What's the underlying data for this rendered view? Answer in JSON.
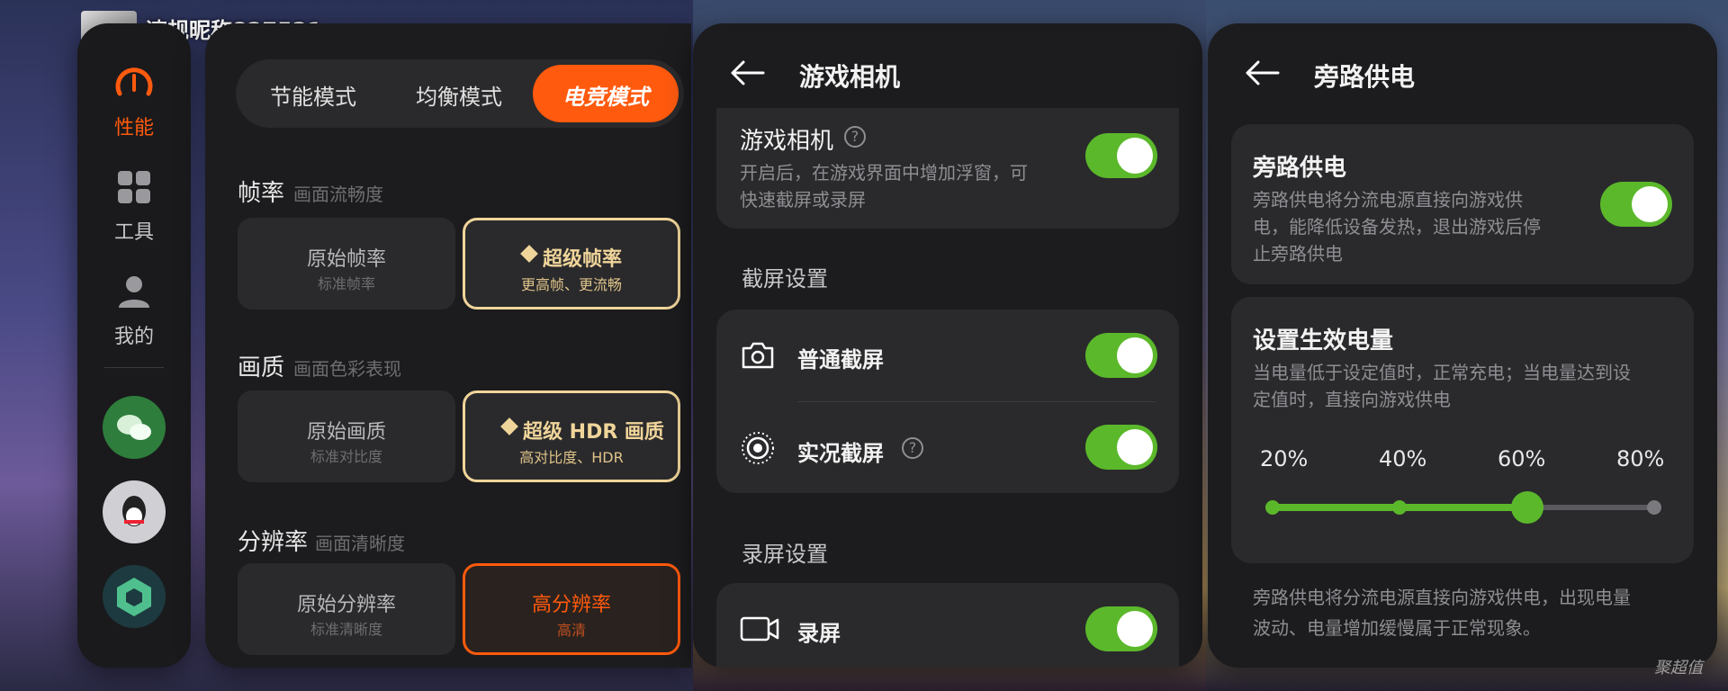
{
  "username": "违规昵称827521",
  "left_panel": {
    "nav": [
      {
        "label": "性能",
        "icon": "speedometer-icon",
        "active": true
      },
      {
        "label": "工具",
        "icon": "grid-icon",
        "active": false
      },
      {
        "label": "我的",
        "icon": "person-icon",
        "active": false
      }
    ],
    "apps": [
      "wechat-icon",
      "qq-icon",
      "cube-app-icon"
    ],
    "modes": [
      "节能模式",
      "均衡模式",
      "电竞模式"
    ],
    "active_mode": "电竞模式",
    "sections": [
      {
        "title": "帧率",
        "subtitle": "画面流畅度",
        "options": [
          {
            "title": "原始帧率",
            "desc": "标准帧率",
            "selected": false
          },
          {
            "title": "超级帧率",
            "desc": "更高帧、更流畅",
            "selected": true,
            "premium": true
          }
        ]
      },
      {
        "title": "画质",
        "subtitle": "画面色彩表现",
        "options": [
          {
            "title": "原始画质",
            "desc": "标准对比度",
            "selected": false
          },
          {
            "title": "超级 HDR 画质",
            "desc": "高对比度、HDR",
            "selected": true,
            "premium": true
          }
        ]
      },
      {
        "title": "分辨率",
        "subtitle": "画面清晰度",
        "options": [
          {
            "title": "原始分辨率",
            "desc": "标准清晰度",
            "selected": false
          },
          {
            "title": "高分辨率",
            "desc": "高清",
            "selected": true,
            "premium": false
          }
        ]
      }
    ]
  },
  "camera_panel": {
    "title": "游戏相机",
    "main_toggle": {
      "label": "游戏相机",
      "desc_line1": "开启后，在游戏界面中增加浮窗，可",
      "desc_line2": "快速截屏或录屏",
      "on": true
    },
    "screenshot_header": "截屏设置",
    "screenshot_items": [
      {
        "label": "普通截屏",
        "icon": "camera-icon",
        "on": true,
        "help": false
      },
      {
        "label": "实况截屏",
        "icon": "live-photo-icon",
        "on": true,
        "help": true
      }
    ],
    "record_header": "录屏设置",
    "record_items": [
      {
        "label": "录屏",
        "icon": "video-icon",
        "on": true
      }
    ]
  },
  "bypass_panel": {
    "title": "旁路供电",
    "toggle": {
      "label": "旁路供电",
      "desc_line1": "旁路供电将分流电源直接向游戏供",
      "desc_line2": "电，能降低设备发热，退出游戏后停",
      "desc_line3": "止旁路供电",
      "on": true
    },
    "level": {
      "title": "设置生效电量",
      "desc_line1": "当电量低于设定值时，正常充电；当电量达到设",
      "desc_line2": "定值时，直接向游戏供电",
      "ticks": [
        "20%",
        "40%",
        "60%",
        "80%"
      ],
      "selected": "60%",
      "selected_fraction": 0.667
    },
    "note_line1": "旁路供电将分流电源直接向游戏供电，出现电量",
    "note_line2": "波动、电量增加缓慢属于正常现象。"
  },
  "watermark": "聚超值",
  "colors": {
    "accent_orange": "#ff5a0e",
    "toggle_green": "#5bb82b",
    "gold": "#f0d59a",
    "panel": "#1c1c1e",
    "card": "#2a2a2c"
  }
}
